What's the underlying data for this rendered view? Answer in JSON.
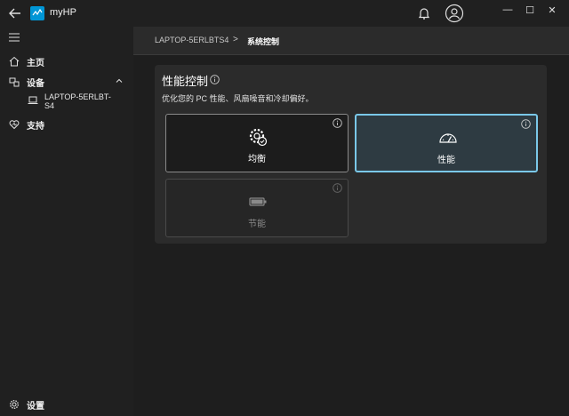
{
  "app": {
    "title": "myHP",
    "brand_color": "#0096d6",
    "icons": {
      "back": "back-arrow-icon",
      "notifications": "bell-icon",
      "account": "account-icon"
    },
    "window_controls": {
      "minimize": "—",
      "maximize": "☐",
      "close": "✕"
    }
  },
  "sidebar": {
    "menu_icon": "hamburger-icon",
    "items": [
      {
        "label": "主页",
        "icon": "home-icon"
      },
      {
        "label": "设备",
        "icon": "devices-icon",
        "expanded": true
      },
      {
        "label": "支持",
        "icon": "support-heart-icon"
      }
    ],
    "device": {
      "label": "LAPTOP-5ERLBT-S4",
      "icon": "laptop-icon"
    },
    "settings": {
      "label": "设置",
      "icon": "gear-icon"
    }
  },
  "breadcrumb": {
    "device": "LAPTOP-5ERLBTS4",
    "separator": ">",
    "current": "系统控制"
  },
  "panel": {
    "title": "性能控制",
    "description": "优化您的 PC 性能、风扇噪音和冷却偏好。",
    "modes": [
      {
        "label": "均衡",
        "icon": "balanced-gear-icon",
        "selected": false,
        "enabled": true
      },
      {
        "label": "性能",
        "icon": "speedometer-icon",
        "selected": true,
        "enabled": true
      },
      {
        "label": "节能",
        "icon": "battery-icon",
        "selected": false,
        "enabled": false
      }
    ]
  },
  "colors": {
    "selected_border": "#7ac8e8",
    "selected_fill": "#2e3b42",
    "panel_bg": "#2b2b2b"
  }
}
